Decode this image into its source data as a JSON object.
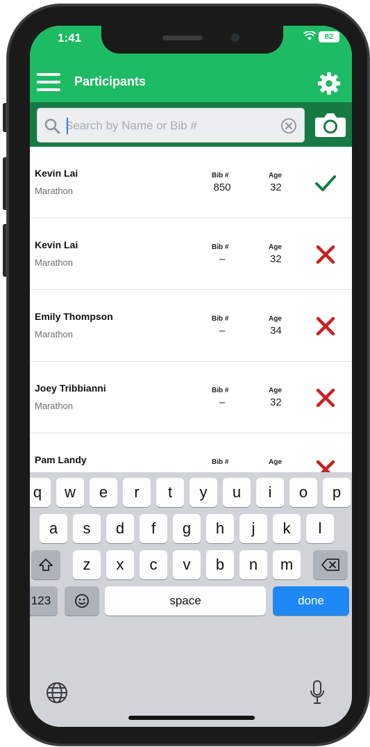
{
  "status_bar": {
    "time": "1:41",
    "battery": "82"
  },
  "header": {
    "title": "Participants"
  },
  "search": {
    "placeholder": "Search by Name or Bib #"
  },
  "columns": {
    "bib": "Bib #",
    "age": "Age"
  },
  "participants": [
    {
      "name": "Kevin Lai",
      "event": "Marathon",
      "bib": "850",
      "age": "32",
      "status": "checked"
    },
    {
      "name": "Kevin Lai",
      "event": "Marathon",
      "bib": "–",
      "age": "32",
      "status": "not-checked"
    },
    {
      "name": "Emily Thompson",
      "event": "Marathon",
      "bib": "–",
      "age": "34",
      "status": "not-checked"
    },
    {
      "name": "Joey Tribbianni",
      "event": "Marathon",
      "bib": "–",
      "age": "32",
      "status": "not-checked"
    },
    {
      "name": "Pam Landy",
      "event": "",
      "bib": "",
      "age": "",
      "status": "not-checked"
    }
  ],
  "colors": {
    "primary": "#1dbb63",
    "primary_dark": "#177a44",
    "check": "#1a7a45",
    "cross": "#c8201e",
    "done_key": "#1e88f4"
  },
  "keyboard": {
    "row1": [
      "q",
      "w",
      "e",
      "r",
      "t",
      "y",
      "u",
      "i",
      "o",
      "p"
    ],
    "row2": [
      "a",
      "s",
      "d",
      "f",
      "g",
      "h",
      "j",
      "k",
      "l"
    ],
    "row3": [
      "z",
      "x",
      "c",
      "v",
      "b",
      "n",
      "m"
    ],
    "numbers_key": "123",
    "space_key": "space",
    "done_key": "done"
  },
  "icons": {
    "menu": "hamburger-menu-icon",
    "settings": "gear-icon",
    "search": "magnifier-icon",
    "clear": "clear-circle-icon",
    "scan": "camera-icon",
    "checked": "checkmark-icon",
    "not_checked": "cross-icon",
    "shift": "shift-icon",
    "delete": "backspace-icon",
    "emoji": "emoji-icon",
    "globe": "globe-icon",
    "mic": "microphone-icon"
  }
}
